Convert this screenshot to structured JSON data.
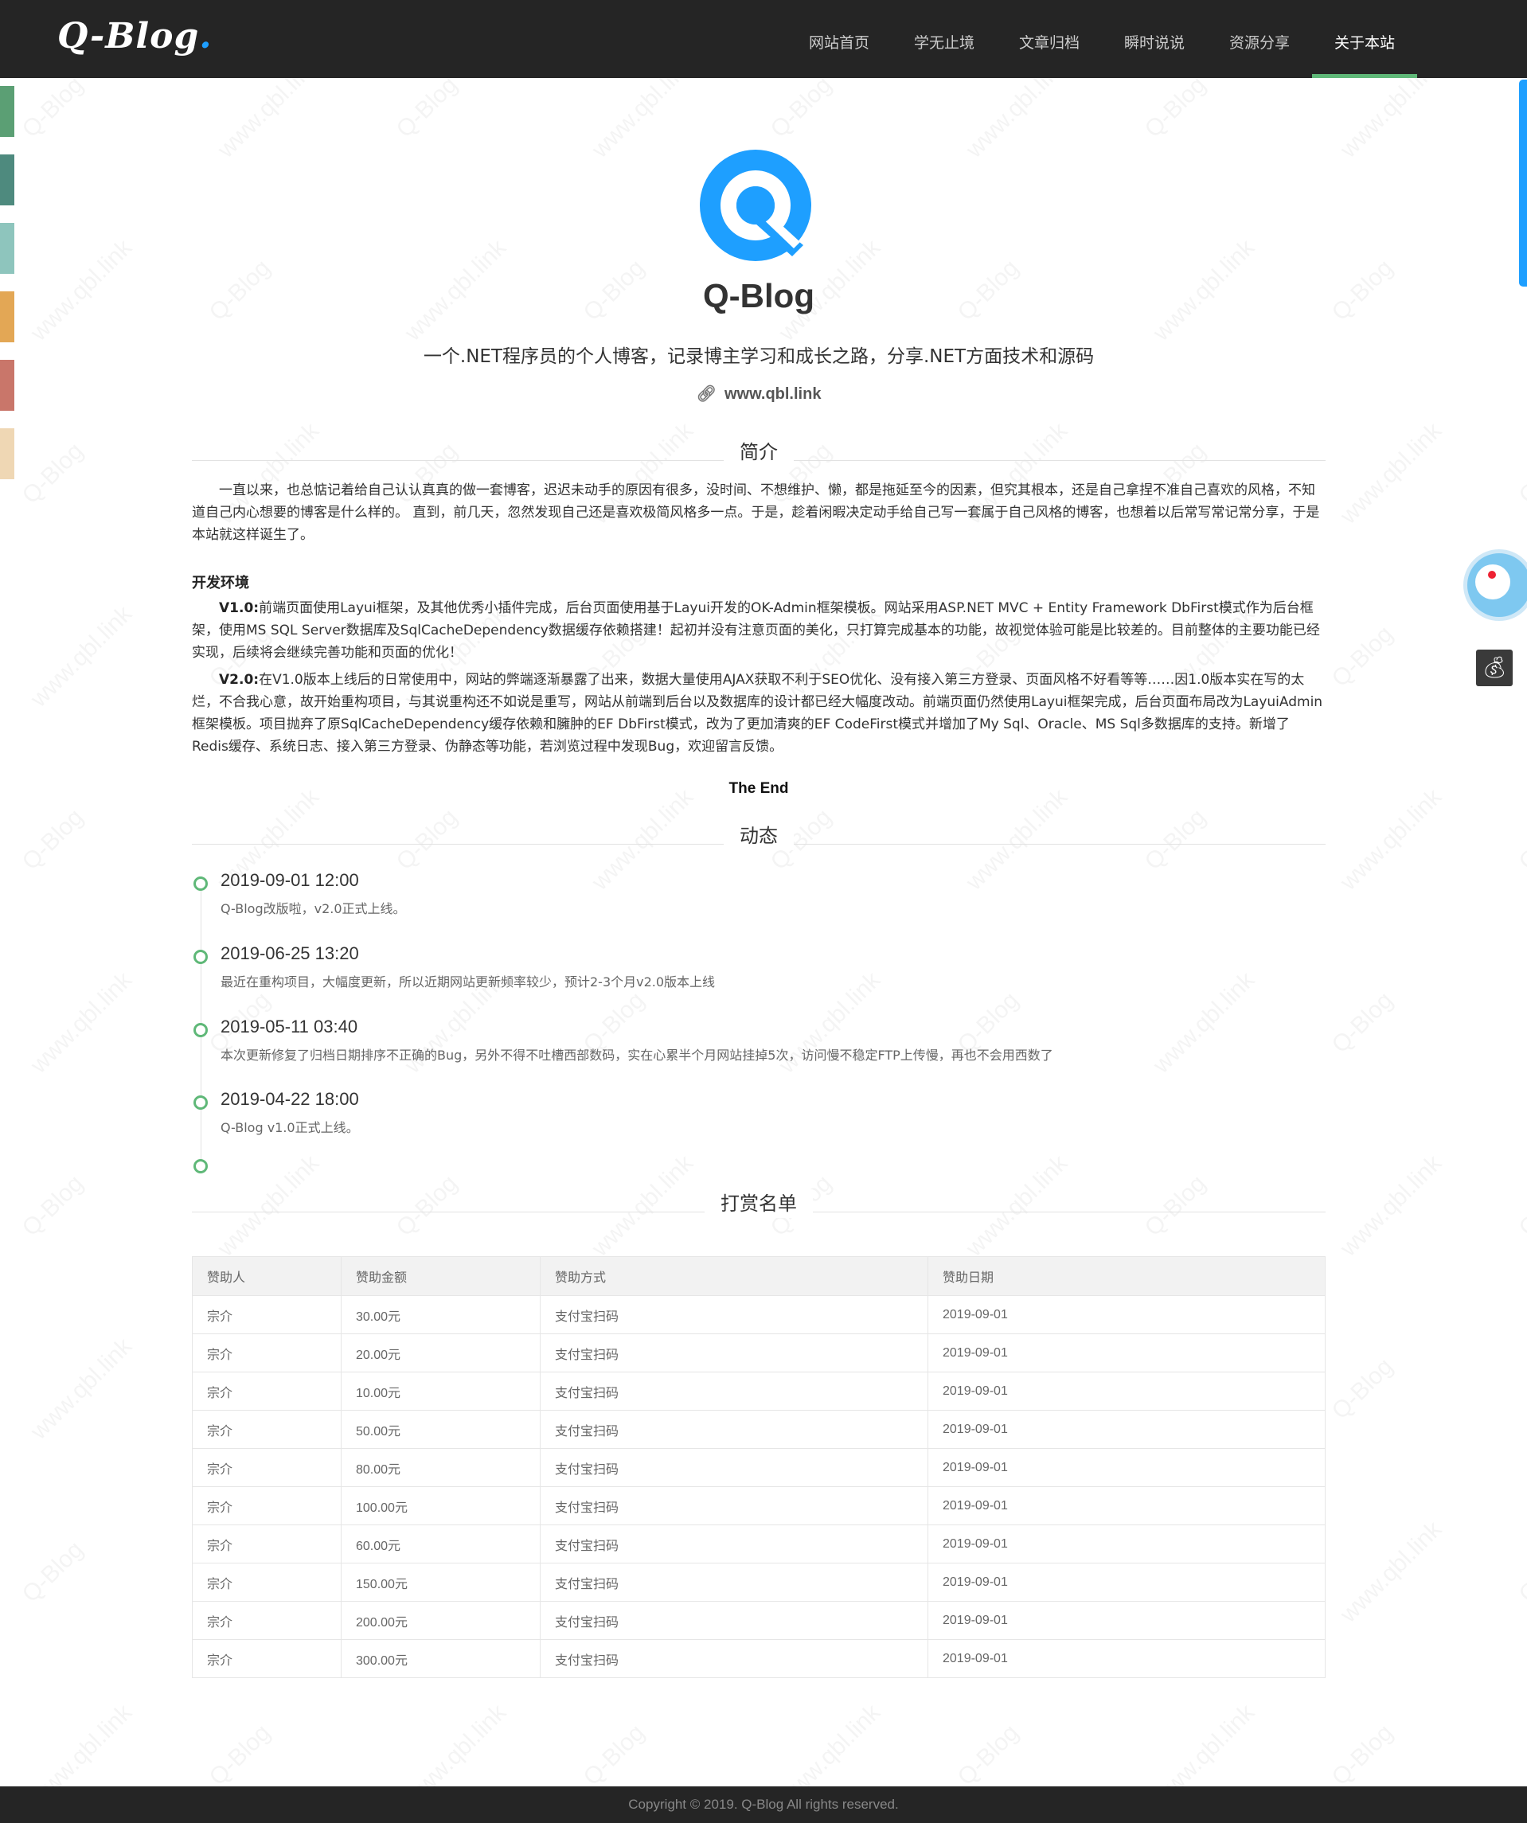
{
  "header": {
    "logo_text": "Q-Blog",
    "nav": [
      {
        "label": "网站首页",
        "active": false
      },
      {
        "label": "学无止境",
        "active": false
      },
      {
        "label": "文章归档",
        "active": false
      },
      {
        "label": "瞬时说说",
        "active": false
      },
      {
        "label": "资源分享",
        "active": false
      },
      {
        "label": "关于本站",
        "active": true
      }
    ]
  },
  "side_tabs": [
    {
      "color": "#5b9f74"
    },
    {
      "color": "#4e8a7e"
    },
    {
      "color": "#8ec5bd"
    },
    {
      "color": "#e3a755"
    },
    {
      "color": "#c9766a"
    },
    {
      "color": "#efd7b4"
    }
  ],
  "profile": {
    "name": "Q-Blog",
    "description": "一个.NET程序员的个人博客，记录博主学习和成长之路，分享.NET方面技术和源码",
    "link_text": "www.qbl.link",
    "brand_color": "#1e9fff"
  },
  "intro": {
    "title": "简介",
    "paragraph": "一直以来，也总惦记着给自己认认真真的做一套博客，迟迟未动手的原因有很多，没时间、不想维护、懒，都是拖延至今的因素，但究其根本，还是自己拿捏不准自己喜欢的风格，不知道自己内心想要的博客是什么样的。 直到，前几天，忽然发现自己还是喜欢极简风格多一点。于是，趁着闲暇决定动手给自己写一套属于自己风格的博客，也想着以后常写常记常分享，于是本站就这样诞生了。",
    "env_title": "开发环境",
    "v1_label": "V1.0:",
    "v1_text": "前端页面使用Layui框架，及其他优秀小插件完成，后台页面使用基于Layui开发的OK-Admin框架模板。网站采用ASP.NET MVC + Entity Framework DbFirst模式作为后台框架，使用MS SQL Server数据库及SqlCacheDependency数据缓存依赖搭建！起初并没有注意页面的美化，只打算完成基本的功能，故视觉体验可能是比较差的。目前整体的主要功能已经实现，后续将会继续完善功能和页面的优化！",
    "v2_label": "V2.0:",
    "v2_text": "在V1.0版本上线后的日常使用中，网站的弊端逐渐暴露了出来，数据大量使用AJAX获取不利于SEO优化、没有接入第三方登录、页面风格不好看等等……因1.0版本实在写的太烂，不合我心意，故开始重构项目，与其说重构还不如说是重写，网站从前端到后台以及数据库的设计都已经大幅度改动。前端页面仍然使用Layui框架完成，后台页面布局改为LayuiAdmin框架模板。项目抛弃了原SqlCacheDependency缓存依赖和臃肿的EF DbFirst模式，改为了更加清爽的EF CodeFirst模式并增加了My Sql、Oracle、MS Sql多数据库的支持。新增了Redis缓存、系统日志、接入第三方登录、伪静态等功能，若浏览过程中发现Bug，欢迎留言反馈。",
    "end_text": "The End"
  },
  "timeline": {
    "title": "动态",
    "accent_color": "#5fb878",
    "items": [
      {
        "date": "2019-09-01 12:00",
        "text": "Q-Blog改版啦，v2.0正式上线。"
      },
      {
        "date": "2019-06-25 13:20",
        "text": "最近在重构项目，大幅度更新，所以近期网站更新频率较少，预计2-3个月v2.0版本上线"
      },
      {
        "date": "2019-05-11 03:40",
        "text": "本次更新修复了归档日期排序不正确的Bug，另外不得不吐槽西部数码，实在心累半个月网站挂掉5次，访问慢不稳定FTP上传慢，再也不会用西数了"
      },
      {
        "date": "2019-04-22 18:00",
        "text": "Q-Blog v1.0正式上线。"
      }
    ]
  },
  "rewards": {
    "title": "打赏名单",
    "columns": [
      "赞助人",
      "赞助金额",
      "赞助方式",
      "赞助日期"
    ],
    "rows": [
      [
        "宗介",
        "30.00元",
        "支付宝扫码",
        "2019-09-01"
      ],
      [
        "宗介",
        "20.00元",
        "支付宝扫码",
        "2019-09-01"
      ],
      [
        "宗介",
        "10.00元",
        "支付宝扫码",
        "2019-09-01"
      ],
      [
        "宗介",
        "50.00元",
        "支付宝扫码",
        "2019-09-01"
      ],
      [
        "宗介",
        "80.00元",
        "支付宝扫码",
        "2019-09-01"
      ],
      [
        "宗介",
        "100.00元",
        "支付宝扫码",
        "2019-09-01"
      ],
      [
        "宗介",
        "60.00元",
        "支付宝扫码",
        "2019-09-01"
      ],
      [
        "宗介",
        "150.00元",
        "支付宝扫码",
        "2019-09-01"
      ],
      [
        "宗介",
        "200.00元",
        "支付宝扫码",
        "2019-09-01"
      ],
      [
        "宗介",
        "300.00元",
        "支付宝扫码",
        "2019-09-01"
      ]
    ]
  },
  "widgets": {
    "avatar_icon": "doraemon-avatar-icon",
    "money_icon": "money-bag-icon"
  },
  "watermark_texts": [
    "Q-Blog",
    "www.qbl.link"
  ],
  "footer": {
    "copyright": "Copyright © 2019. Q-Blog All rights reserved."
  }
}
